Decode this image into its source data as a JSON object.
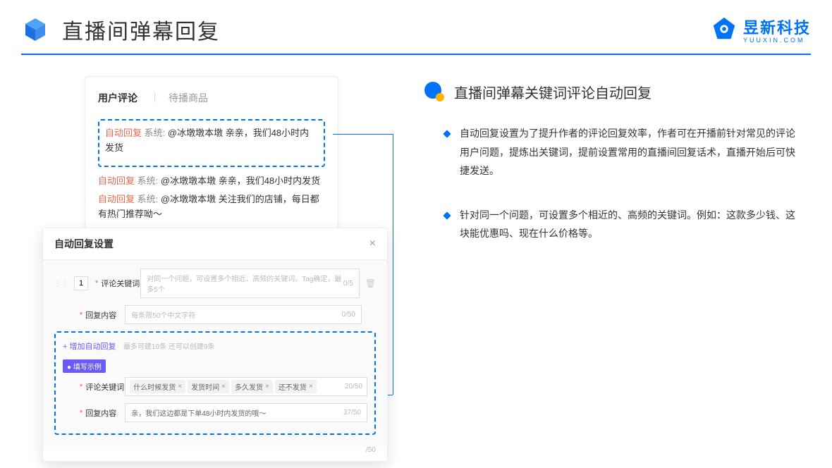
{
  "header": {
    "title": "直播间弹幕回复",
    "logo_text": "昱新科技",
    "logo_sub": "YUUXIN.COM"
  },
  "comment_card": {
    "tab_active": "用户评论",
    "tab_inactive": "待播商品",
    "auto_reply_label": "自动回复",
    "sys_label": "系统:",
    "comment1": "@冰墩墩本墩 亲亲，我们48小时内发货",
    "comment2": "@冰墩墩本墩 亲亲，我们48小时内发货",
    "comment3": "@冰墩墩本墩 关注我们的店铺，每日都有热门推荐呦～"
  },
  "settings": {
    "title": "自动回复设置",
    "row_num": "1",
    "keyword_label": "评论关键词",
    "keyword_placeholder": "对同一个问题，可设置多个相近、高频的关键词。Tag确定，最多5个",
    "keyword_count": "0/5",
    "content_label": "回复内容",
    "content_placeholder": "每条限50个中文字符",
    "content_count": "0/50",
    "add_link": "+ 增加自动回复",
    "add_info": "最多可建10条 还可以创建9条",
    "example_badge": "● 填写示例",
    "ex_keyword_label": "评论关键词",
    "ex_tags": [
      "什么时候发货",
      "发货时间",
      "多久发货",
      "还不发货"
    ],
    "ex_keyword_count": "20/50",
    "ex_content_label": "回复内容",
    "ex_content_text": "亲，我们这边都是下单48小时内发货的哦～",
    "ex_content_count": "37/50",
    "under_count": "/50"
  },
  "right": {
    "heading": "直播间弹幕关键词评论自动回复",
    "bullet1": "自动回复设置为了提升作者的评论回复效率，作者可在开播前针对常见的评论用户问题，提炼出关键词，提前设置常用的直播间回复话术，直播开始后可快捷发送。",
    "bullet2": "针对同一个问题，可设置多个相近的、高频的关键词。例如：这款多少钱、这块能优惠吗、现在什么价格等。"
  }
}
